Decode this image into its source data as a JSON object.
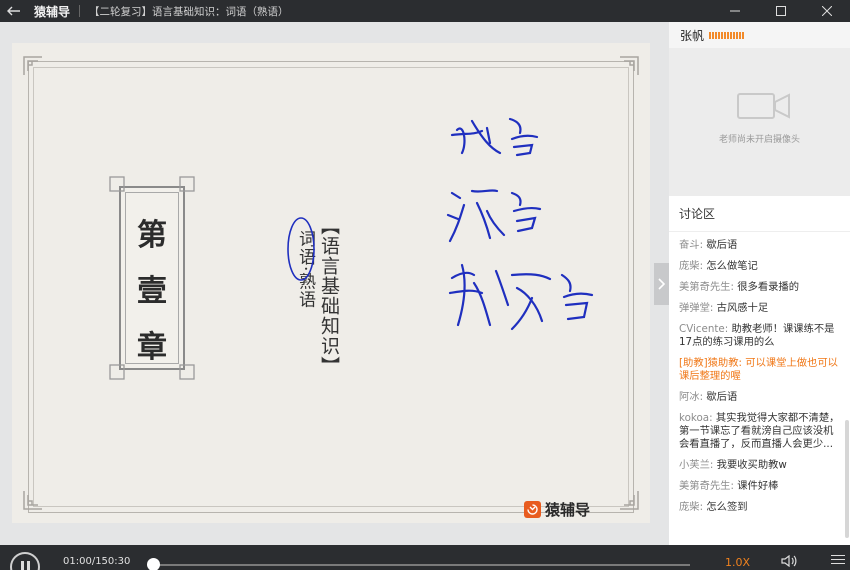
{
  "titlebar": {
    "app_name": "猿辅导",
    "course_title": "【二轮复习】语言基础知识：词语（熟语）",
    "back_icon": "back-arrow-icon",
    "minimize_icon": "minimize-icon",
    "maximize_icon": "maximize-icon",
    "close_icon": "close-icon"
  },
  "slide": {
    "chapter_chars": [
      "第",
      "壹",
      "章"
    ],
    "title_vertical": "【语言基础知识】",
    "subtitle_vertical": "词语·熟语",
    "logo_text": "猿辅导",
    "logo_color": "#e85c1f",
    "ink_color": "#1f2fbf"
  },
  "teacher": {
    "name": "张帆",
    "signal_color": "#f28a2a",
    "camera_status": "老师尚未开启摄像头"
  },
  "discussion": {
    "title": "讨论区",
    "messages": [
      {
        "user": "奋斗:",
        "text": "歇后语"
      },
      {
        "user": "庞柴:",
        "text": "怎么做笔记"
      },
      {
        "user": "美第奇先生:",
        "text": "很多看录播的"
      },
      {
        "user": "弹弹堂:",
        "text": "古风感十足"
      },
      {
        "user": "CVicente:",
        "text": "助教老师！课课练不是17点的练习课用的么"
      },
      {
        "user": "[助教]猿助教:",
        "text": "可以课堂上做也可以课后整理的喔",
        "assistant": true
      },
      {
        "user": "阿冰:",
        "text": "歇后语"
      },
      {
        "user": "kokoa:",
        "text": "其实我觉得大家都不清楚，第一节课忘了看就滂自己应该没机会看直播了，反而直播人会更少..."
      },
      {
        "user": "小芙兰:",
        "text": "我要收买助教w"
      },
      {
        "user": "美第奇先生:",
        "text": "课件好棒"
      },
      {
        "user": "庞柴:",
        "text": "怎么签到"
      }
    ],
    "assistant_color": "#f07818"
  },
  "player": {
    "time": "01:00/150:30",
    "progress": 0.0066,
    "speed": "1.0X",
    "pause_icon": "pause-icon",
    "volume_icon": "volume-icon",
    "menu_icon": "menu-icon"
  }
}
